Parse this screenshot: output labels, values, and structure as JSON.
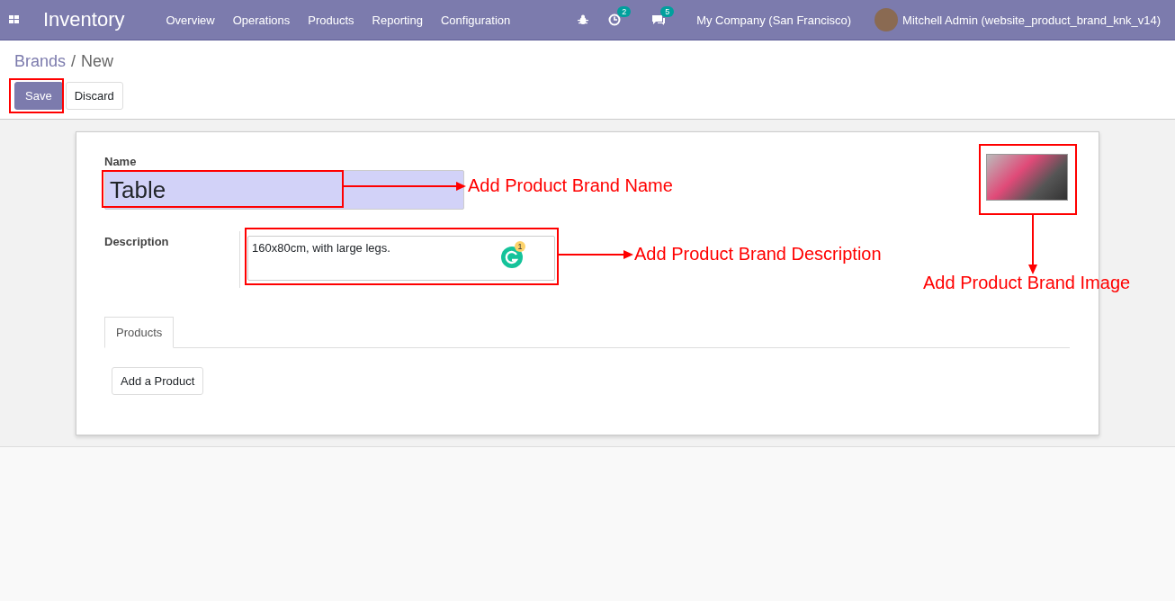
{
  "navbar": {
    "app_name": "Inventory",
    "menu": [
      "Overview",
      "Operations",
      "Products",
      "Reporting",
      "Configuration"
    ],
    "activity_count": "2",
    "message_count": "5",
    "company": "My Company (San Francisco)",
    "user": "Mitchell Admin (website_product_brand_knk_v14)"
  },
  "breadcrumb": [
    {
      "label": "Brands",
      "link": true
    },
    {
      "label": "New",
      "link": false
    }
  ],
  "breadcrumb_separator": "/",
  "buttons": [
    {
      "label": "Save",
      "kind": "primary"
    },
    {
      "label": "Discard",
      "kind": "secondary"
    }
  ],
  "form": {
    "name_label": "Name",
    "name_value": "Table",
    "description_label": "Description",
    "description_value": "160x80cm, with large legs.",
    "grammarly_badge": "1",
    "tabs": [
      {
        "label": "Products",
        "selected": true
      }
    ],
    "add_line": "Add a Product"
  },
  "annotations": [
    {
      "kind": "box-only"
    },
    {
      "kind": "right",
      "text": "Add Product Brand Name"
    },
    {
      "kind": "right",
      "text": "Add Product Brand Description"
    },
    {
      "kind": "down",
      "text": "Add Product Brand Image"
    }
  ]
}
